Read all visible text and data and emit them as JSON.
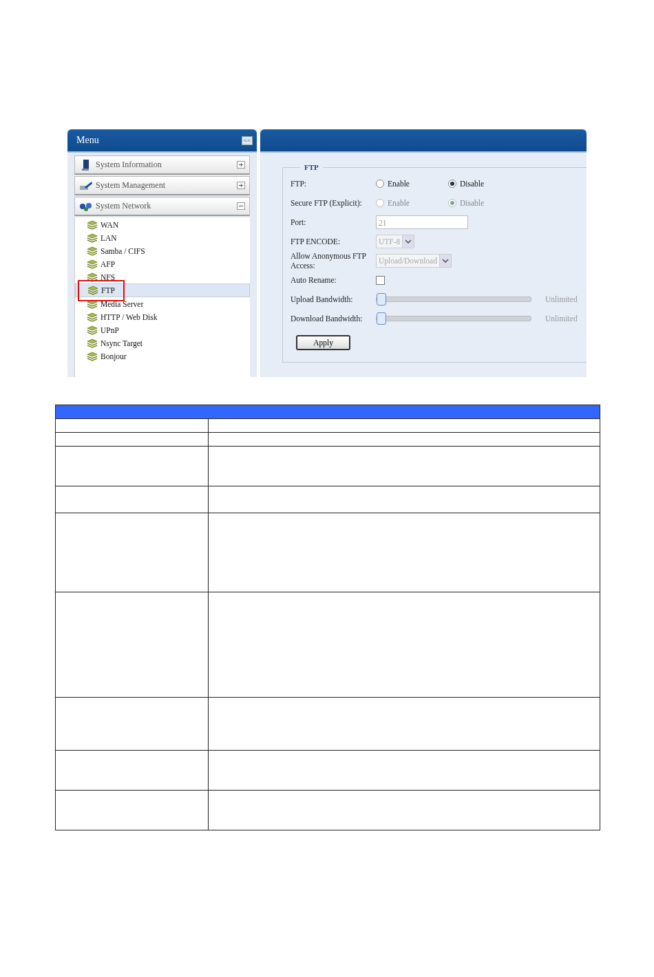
{
  "menu": {
    "title": "Menu",
    "collapse_label": "<<",
    "sections": [
      {
        "label": "System Information",
        "expanded": false
      },
      {
        "label": "System Management",
        "expanded": false
      },
      {
        "label": "System Network",
        "expanded": true,
        "items": [
          {
            "label": "WAN",
            "selected": false,
            "highlighted": false
          },
          {
            "label": "LAN",
            "selected": false,
            "highlighted": false
          },
          {
            "label": "Samba / CIFS",
            "selected": false,
            "highlighted": false
          },
          {
            "label": "AFP",
            "selected": false,
            "highlighted": false
          },
          {
            "label": "NFS",
            "selected": false,
            "highlighted": false
          },
          {
            "label": "FTP",
            "selected": true,
            "highlighted": true
          },
          {
            "label": "Media Server",
            "selected": false,
            "highlighted": false
          },
          {
            "label": "HTTP / Web Disk",
            "selected": false,
            "highlighted": false
          },
          {
            "label": "UPnP",
            "selected": false,
            "highlighted": false
          },
          {
            "label": "Nsync Target",
            "selected": false,
            "highlighted": false
          },
          {
            "label": "Bonjour",
            "selected": false,
            "highlighted": false
          }
        ]
      }
    ]
  },
  "ftp_form": {
    "legend": "FTP",
    "rows": [
      {
        "kind": "radio",
        "label": "FTP:",
        "disabled": false,
        "options": [
          {
            "label": "Enable",
            "selected": false
          },
          {
            "label": "Disable",
            "selected": true
          }
        ]
      },
      {
        "kind": "radio",
        "label": "Secure FTP (Explicit):",
        "disabled": true,
        "options": [
          {
            "label": "Enable",
            "selected": false
          },
          {
            "label": "Disable",
            "selected": true
          }
        ]
      },
      {
        "kind": "text",
        "label": "Port:",
        "value": "21",
        "disabled": true
      },
      {
        "kind": "select",
        "label": "FTP ENCODE:",
        "value": "UTF-8",
        "disabled": true
      },
      {
        "kind": "select",
        "label": "Allow Anonymous FTP Access:",
        "value": "Upload/Download",
        "disabled": true
      },
      {
        "kind": "checkbox",
        "label": "Auto Rename:",
        "checked": false
      },
      {
        "kind": "slider",
        "label": "Upload Bandwidth:",
        "level": 0,
        "reading": "Unlimited"
      },
      {
        "kind": "slider",
        "label": "Download Bandwidth:",
        "level": 0,
        "reading": "Unlimited"
      }
    ],
    "apply_button": "Apply"
  }
}
